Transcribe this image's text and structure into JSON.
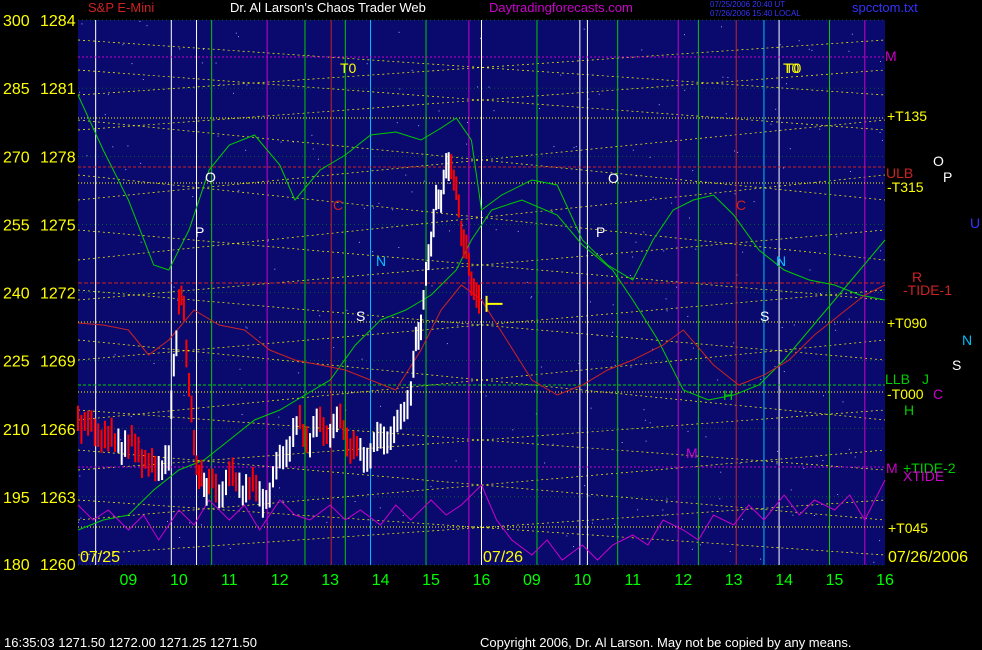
{
  "header": {
    "symbol": "S&P E-Mini",
    "title": "Dr. Al Larson's Chaos Trader Web",
    "site": "Daytradingforecasts.com",
    "stamp_line1": "07/25/2006 20:40 UT",
    "stamp_line2": "07/26/2006 15:40 LOCAL",
    "file": "spcctom.txt"
  },
  "footer": {
    "quote": "16:35:03  1271.50 1272.00 1271.25 1271.50",
    "copyright": "Copyright 2006, Dr. Al Larson. May not be copied by any means."
  },
  "colors": {
    "background": "#0a0a6e",
    "price_up": "#ffffff",
    "price_down": "#ff0000",
    "axis_label": "#ffff00",
    "hour_label": "#00ff00",
    "tide_line": "#00cc00",
    "red_tide": "#cc2222",
    "xtide": "#cc00cc"
  },
  "chart_data": {
    "type": "line",
    "title": "S&P E-Mini",
    "y_left": {
      "labels": [
        "300",
        "285",
        "270",
        "255",
        "240",
        "225",
        "210",
        "195",
        "180"
      ],
      "values": [
        300,
        285,
        270,
        255,
        240,
        225,
        210,
        195,
        180
      ]
    },
    "y_price": {
      "labels": [
        "1284",
        "1281",
        "1278",
        "1275",
        "1272",
        "1269",
        "1266",
        "1263",
        "1260"
      ],
      "values": [
        1284,
        1281,
        1278,
        1275,
        1272,
        1269,
        1266,
        1263,
        1260
      ],
      "ylim": [
        1260,
        1284
      ]
    },
    "x_hours": [
      "09",
      "10",
      "11",
      "12",
      "13",
      "14",
      "15",
      "16",
      "09",
      "10",
      "11",
      "12",
      "13",
      "14",
      "15",
      "16"
    ],
    "dates": {
      "start": "07/25",
      "mid": "07/26",
      "end": "07/26/2006"
    },
    "price": {
      "name": "S&P E-Mini",
      "hours": [
        8.0,
        8.2,
        8.4,
        8.6,
        8.8,
        9.0,
        9.2,
        9.4,
        9.6,
        9.8,
        9.9,
        10.0,
        10.1,
        10.2,
        10.3,
        10.4,
        10.5,
        10.6,
        10.8,
        11.0,
        11.2,
        11.4,
        11.6,
        11.8,
        12.0,
        12.2,
        12.4,
        12.6,
        12.8,
        13.0,
        13.2,
        13.4,
        13.6,
        13.8,
        14.0,
        14.2,
        14.4,
        14.6,
        14.7,
        14.8,
        14.9,
        15.0,
        15.1,
        15.2,
        15.3,
        15.4,
        15.5,
        15.6,
        15.7,
        15.8,
        15.9,
        16.0
      ],
      "values": [
        1266.4,
        1266.2,
        1265.8,
        1265.6,
        1265.3,
        1265.4,
        1265.0,
        1264.4,
        1264.2,
        1264.9,
        1268.5,
        1271.8,
        1271.2,
        1268.0,
        1265.2,
        1264.2,
        1263.2,
        1263.9,
        1262.9,
        1264.2,
        1263.2,
        1263.8,
        1262.8,
        1263.3,
        1264.6,
        1265.4,
        1266.1,
        1265.7,
        1266.1,
        1265.9,
        1266.3,
        1265.4,
        1264.6,
        1265.2,
        1265.4,
        1265.8,
        1266.2,
        1268.0,
        1269.5,
        1270.8,
        1272.6,
        1274.4,
        1275.8,
        1276.5,
        1277.2,
        1277.8,
        1276.4,
        1274.9,
        1273.6,
        1272.8,
        1271.6,
        1271.5
      ]
    },
    "last_price": 1271.5,
    "forecast_labels": [
      "O",
      "P",
      "S",
      "N",
      "C",
      "H",
      "M",
      "T0"
    ],
    "right_labels": [
      {
        "text": "M",
        "color": "#cc00cc"
      },
      {
        "text": "T0",
        "color": "#ffff00"
      },
      {
        "text": "+T135",
        "color": "#ffff00"
      },
      {
        "text": "O",
        "color": "#ffffff"
      },
      {
        "text": "ULB",
        "color": "#cc2222"
      },
      {
        "text": "P",
        "color": "#ffffff"
      },
      {
        "text": "-T315",
        "color": "#ffff00"
      },
      {
        "text": "U",
        "color": "#3333ff"
      },
      {
        "text": "R",
        "color": "#cc2222"
      },
      {
        "text": "-TIDE-1",
        "color": "#cc2222"
      },
      {
        "text": "+T090",
        "color": "#ffff00"
      },
      {
        "text": "N",
        "color": "#00bfff"
      },
      {
        "text": "S",
        "color": "#ffffff"
      },
      {
        "text": "LLB",
        "color": "#00cc00"
      },
      {
        "text": "J",
        "color": "#00cc00"
      },
      {
        "text": "-T000",
        "color": "#ffff00"
      },
      {
        "text": "C",
        "color": "#cc00cc"
      },
      {
        "text": "H",
        "color": "#00cc00"
      },
      {
        "text": "M",
        "color": "#cc00cc"
      },
      {
        "text": "+TIDE-2",
        "color": "#00cc00"
      },
      {
        "text": "XTIDE",
        "color": "#cc00cc"
      },
      {
        "text": "+T045",
        "color": "#ffff00"
      }
    ]
  }
}
